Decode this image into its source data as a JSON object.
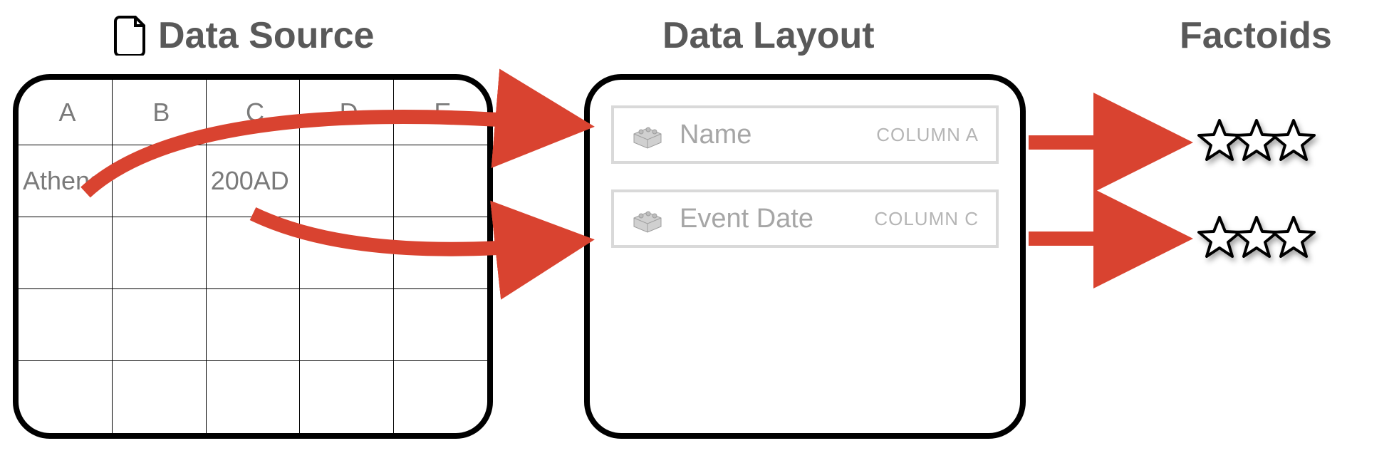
{
  "headings": {
    "source": "Data Source",
    "layout": "Data Layout",
    "factoids": "Factoids"
  },
  "source": {
    "columns": [
      "A",
      "B",
      "C",
      "D",
      "E"
    ],
    "rows": [
      [
        "Athens",
        "",
        "200AD",
        "",
        ""
      ],
      [
        "",
        "",
        "",
        "",
        ""
      ],
      [
        "",
        "",
        "",
        "",
        ""
      ],
      [
        "",
        "",
        "",
        "",
        ""
      ]
    ]
  },
  "layout": {
    "items": [
      {
        "label": "Name",
        "column": "COLUMN A"
      },
      {
        "label": "Event Date",
        "column": "COLUMN C"
      }
    ]
  },
  "colors": {
    "arrow": "#D94330"
  }
}
